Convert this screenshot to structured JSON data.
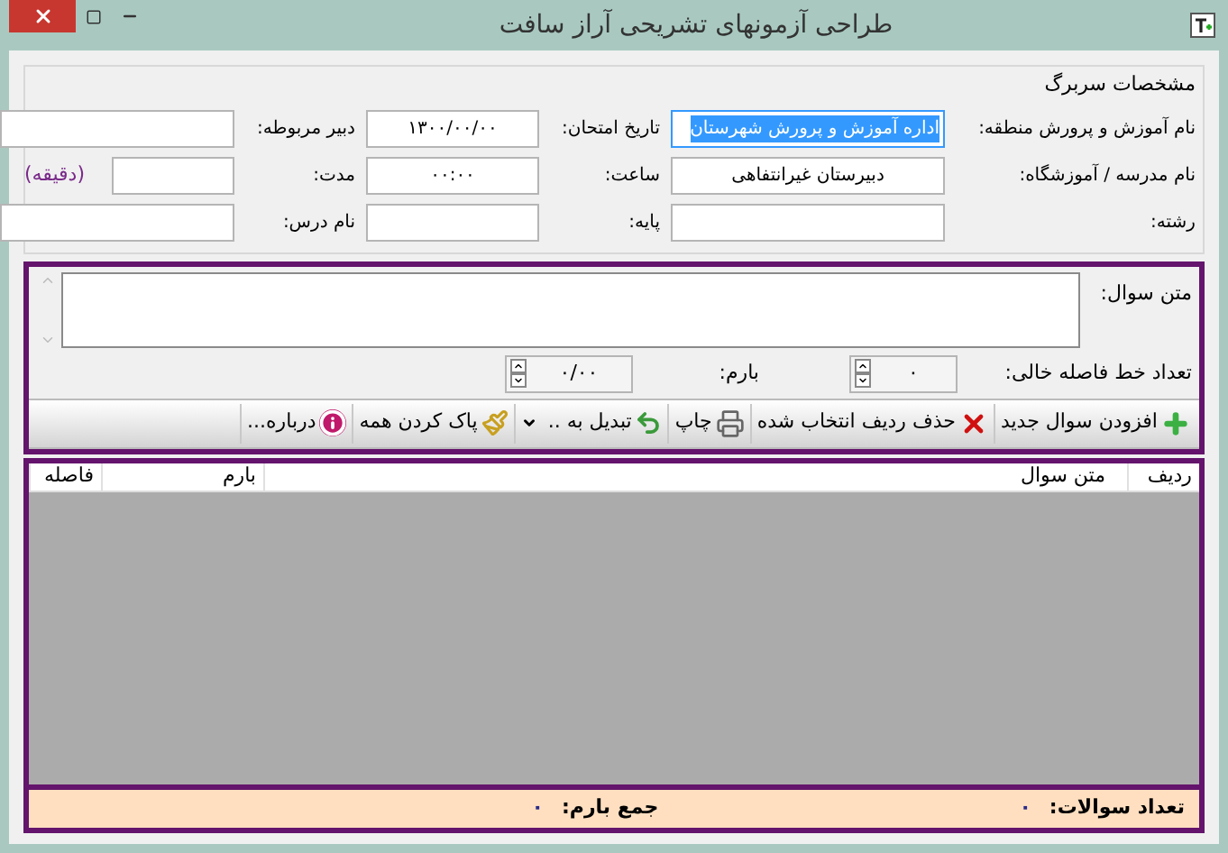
{
  "window": {
    "title": "طراحی آزمونهای تشریحی آراز سافت"
  },
  "header": {
    "title": "مشخصات سربرگ",
    "rows": [
      [
        {
          "label": "نام آموزش و پرورش منطقه:",
          "value": "اداره آموزش و پرورش شهرستان",
          "selected": true
        },
        {
          "label": "تاریخ امتحان:",
          "value": "۱۳۰۰/۰۰/۰۰",
          "selected": false
        },
        {
          "label": "دبیر مربوطه:",
          "selected": false
        }
      ],
      [
        {
          "label": "نام مدرسه / آموزشگاه:",
          "value": "دبیرستان غیرانتفاهی",
          "selected": false
        },
        {
          "label": "ساعت:",
          "value": "۰۰:۰۰",
          "selected": false
        },
        {
          "label": "مدت:",
          "selected": false,
          "suffix": "(دقیقه)"
        }
      ],
      [
        {
          "label": "رشته:",
          "selected": false
        },
        {
          "label": "پایه:",
          "selected": false
        },
        {
          "label": "نام درس:",
          "selected": false
        }
      ]
    ]
  },
  "question": {
    "label": "متن سوال:",
    "blank_lines": {
      "label": "تعداد خط فاصله خالی:",
      "value": "۰"
    },
    "score": {
      "label": "بارم:",
      "value": "۰/۰۰"
    }
  },
  "toolbar": [
    {
      "kind": "add",
      "label": "افزودن سوال جدید"
    },
    {
      "kind": "delete",
      "label": "حذف ردیف انتخاب شده"
    },
    {
      "kind": "print",
      "label": "چاپ"
    },
    {
      "kind": "convert",
      "label": "تبدیل به .."
    },
    {
      "kind": "clear",
      "label": "پاک کردن همه"
    },
    {
      "kind": "about",
      "label": "درباره..."
    }
  ],
  "table": {
    "columns": [
      "ردیف",
      "متن سوال",
      "بارم",
      "فاصله"
    ]
  },
  "footer": {
    "count": {
      "label": "تعداد سوالات:",
      "value": "۰"
    },
    "total": {
      "label": "جمع بارم:",
      "value": "۰"
    }
  }
}
